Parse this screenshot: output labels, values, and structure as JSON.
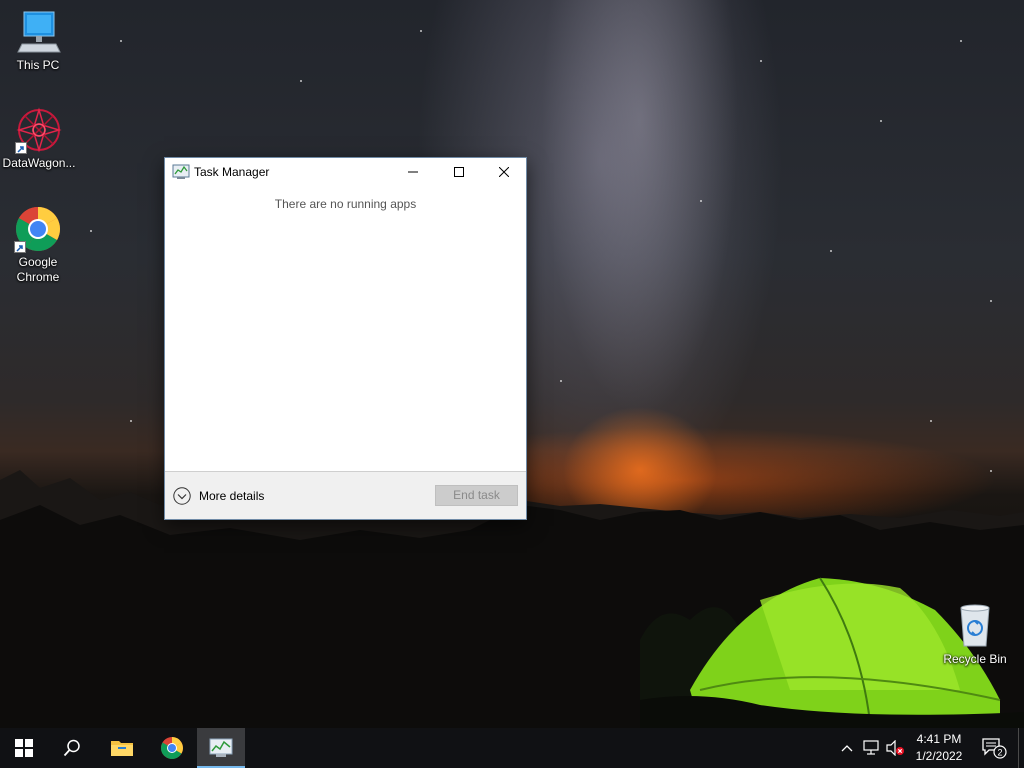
{
  "desktop": {
    "icons": [
      {
        "label": "This PC"
      },
      {
        "label": "DataWagon..."
      },
      {
        "label_line1": "Google",
        "label_line2": "Chrome"
      },
      {
        "label": "Recycle Bin"
      }
    ]
  },
  "task_manager": {
    "title": "Task Manager",
    "empty_message": "There are no running apps",
    "more_details_label": "More details",
    "end_task_label": "End task"
  },
  "taskbar": {
    "pinned": [
      "windows-start",
      "search",
      "file-explorer",
      "google-chrome",
      "task-manager"
    ],
    "clock": {
      "time": "4:41 PM",
      "date": "1/2/2022"
    },
    "notification_count": "2",
    "accent_color": "#76b9ed"
  }
}
